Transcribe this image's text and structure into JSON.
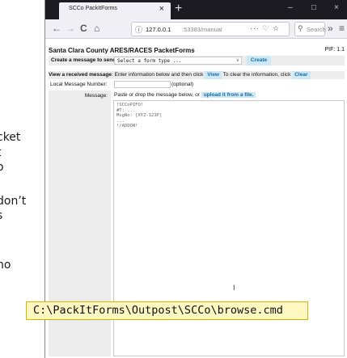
{
  "background_text": [
    "cket",
    "t",
    "o",
    "don’t",
    "s",
    "no"
  ],
  "browser": {
    "tab_title": "SCCo PackItForms",
    "tab_close": "×",
    "new_tab": "+",
    "window_buttons": [
      "–",
      "□",
      "×"
    ],
    "nav": {
      "back": "←",
      "forward": "→",
      "reload": "C",
      "home": "⌂",
      "overflow": "»",
      "menu": "≡"
    },
    "url_host": "127.0.0.1",
    "url_path": ":53383/manual",
    "url_extra": "··· ♡ ☆",
    "search_placeholder": "Search"
  },
  "page": {
    "title": "Santa Clara County ARES/RACES PacketForms",
    "pif": "PIF: 1.1",
    "create_label": "Create a message to send:",
    "form_select_value": "Select a form type ...",
    "create_button": "Create",
    "view_label": "View a received message",
    "view_text": ": Enter information below and then click",
    "view_button": "View",
    "view_text2": "To clear the information, click",
    "clear_button": "Clear",
    "lmn_label": "Local Message Number:",
    "lmn_optional": "(optional)",
    "message_label": "Message:",
    "message_hint": "Paste or drop the message below, or",
    "upload_button": "upload it from a file.",
    "message_lines": "!SCCoPIFO!\n#T: ...\nMsgNo: [XYZ-123P]\n...\n!/ADDON!"
  },
  "path_overlay": "C:\\PackItForms\\Outpost\\SCCo\\browse.cmd"
}
